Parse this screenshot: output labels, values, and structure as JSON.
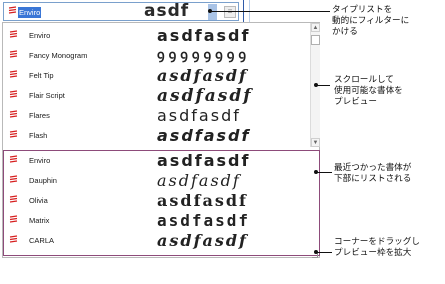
{
  "input": {
    "value": "Enviro",
    "preview": "asdf"
  },
  "fonts": [
    {
      "name": "Enviro",
      "preview": "asdfasdf"
    },
    {
      "name": "Fancy Monogram",
      "preview": "ꝯꝯꝯꝯꝯꝯꝯꝯ"
    },
    {
      "name": "Felt Tip",
      "preview": "asdfasdf"
    },
    {
      "name": "Flair Script",
      "preview": "asdfasdf"
    },
    {
      "name": "Flares",
      "preview": "asdfasdf"
    },
    {
      "name": "Flash",
      "preview": "asdfasdf"
    }
  ],
  "recent_fonts": [
    {
      "name": "Enviro",
      "preview": "asdfasdf"
    },
    {
      "name": "Dauphin",
      "preview": "asdfasdf"
    },
    {
      "name": "Olivia",
      "preview": "asdfasdf"
    },
    {
      "name": "Matrix",
      "preview": "asdfasdf"
    },
    {
      "name": "CARLA",
      "preview": "asdfasdf"
    }
  ],
  "icons": {
    "font_icon": "font-type-icon",
    "scroll_up": "scroll-up-icon",
    "scroll_down": "scroll-down-icon"
  },
  "colors": {
    "icon": "#d62020",
    "selection": "#3a76d6",
    "recent_frame": "#8d4b7a"
  },
  "callouts": {
    "filter": "タイプリストを\n動的にフィルターに\nかける",
    "scroll": "スクロールして\n使用可能な書体を\nプレビュー",
    "recent": "最近つかった書体が\n下部にリストされる",
    "resize": "コーナーをドラッグし\nプレビュー枠を拡大"
  }
}
